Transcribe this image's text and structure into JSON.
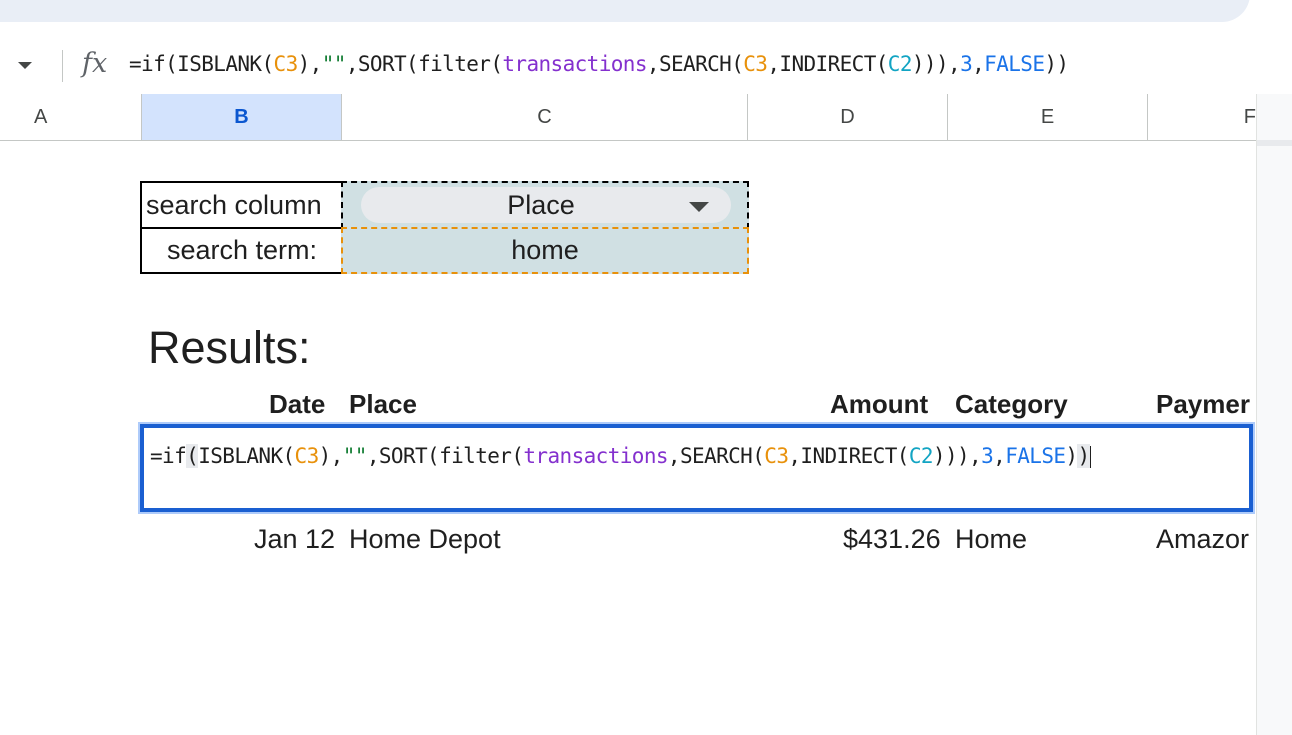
{
  "formula_bar": {
    "fx_label": "fx",
    "formula_parts": [
      {
        "t": "=if(ISBLANK(",
        "c": "dark"
      },
      {
        "t": "C3",
        "c": "orange"
      },
      {
        "t": "),",
        "c": "dark"
      },
      {
        "t": "\"\"",
        "c": "green"
      },
      {
        "t": ",SORT(filter(",
        "c": "dark"
      },
      {
        "t": "transactions",
        "c": "purple"
      },
      {
        "t": ",SEARCH(",
        "c": "dark"
      },
      {
        "t": "C3",
        "c": "orange"
      },
      {
        "t": ",INDIRECT(",
        "c": "dark"
      },
      {
        "t": "C2",
        "c": "cyan"
      },
      {
        "t": "))),",
        "c": "dark"
      },
      {
        "t": "3",
        "c": "blue"
      },
      {
        "t": ",",
        "c": "dark"
      },
      {
        "t": "FALSE",
        "c": "blue"
      },
      {
        "t": "))",
        "c": "dark"
      }
    ]
  },
  "columns": [
    "A",
    "B",
    "C",
    "D",
    "E",
    "F"
  ],
  "search_table": {
    "label_column": "search column",
    "label_term": "search term:",
    "column_value": "Place",
    "term_value": "home"
  },
  "results_title": "Results:",
  "headers": {
    "date": "Date",
    "place": "Place",
    "amount": "Amount",
    "category": "Category",
    "payment": "Paymer"
  },
  "editor": {
    "parts": [
      {
        "t": "=if",
        "c": "dark"
      },
      {
        "t": "(",
        "c": "hl"
      },
      {
        "t": "ISBLANK(",
        "c": "dark"
      },
      {
        "t": "C3",
        "c": "orange"
      },
      {
        "t": "),",
        "c": "dark"
      },
      {
        "t": "\"\"",
        "c": "green"
      },
      {
        "t": ",SORT(filter(",
        "c": "dark"
      },
      {
        "t": "transactions",
        "c": "purple"
      },
      {
        "t": ",SEARCH(",
        "c": "dark"
      },
      {
        "t": "C3",
        "c": "orange"
      },
      {
        "t": ",INDIRECT(",
        "c": "dark"
      },
      {
        "t": "C2",
        "c": "cyan"
      },
      {
        "t": "))),",
        "c": "dark"
      },
      {
        "t": "3",
        "c": "blue"
      },
      {
        "t": ",",
        "c": "dark"
      },
      {
        "t": "FALSE",
        "c": "blue"
      },
      {
        "t": ")",
        "c": "dark"
      },
      {
        "t": ")",
        "c": "hl"
      }
    ]
  },
  "result_row": {
    "date": "Jan 12",
    "place": "Home Depot",
    "amount": "$431.26",
    "category": "Home",
    "payment": "Amazor"
  }
}
